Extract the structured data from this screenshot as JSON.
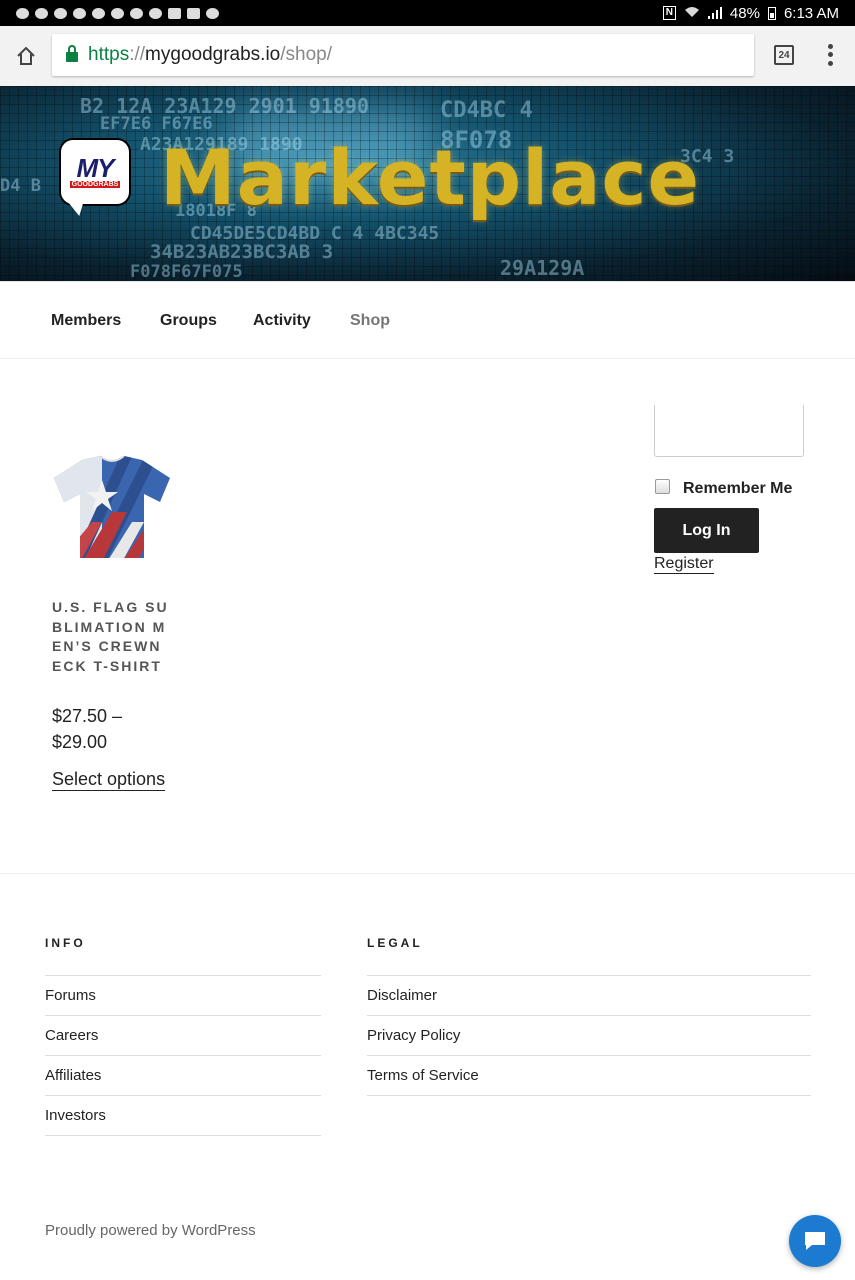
{
  "status_bar": {
    "battery": "48%",
    "time": "6:13 AM"
  },
  "browser": {
    "url_scheme": "https",
    "url_sep": "://",
    "url_host": "mygoodgrabs.io",
    "url_path": "/shop/",
    "tab_count": "24"
  },
  "header": {
    "logo_main": "MY",
    "logo_sub": "GOODGRABS",
    "title": "Marketplace"
  },
  "nav": {
    "items": [
      {
        "label": "Members"
      },
      {
        "label": "Groups"
      },
      {
        "label": "Activity"
      },
      {
        "label": "Shop",
        "current": true
      }
    ]
  },
  "product": {
    "title": "U.S. FLAG SUBLIMATION MEN’S CREWNECK T-SHIRT",
    "price_line1": "$27.50 –",
    "price_line2": "$29.00",
    "button": "Select options"
  },
  "login": {
    "remember_label": "Remember Me",
    "login_button": "Log In",
    "register_link": "Register"
  },
  "footer": {
    "info": {
      "heading": "INFO",
      "links": [
        "Forums",
        "Careers",
        "Affiliates",
        "Investors"
      ]
    },
    "legal": {
      "heading": "LEGAL",
      "links": [
        "Disclaimer",
        "Privacy Policy",
        "Terms of Service"
      ]
    },
    "powered": "Proudly powered by WordPress"
  },
  "colors": {
    "url_green": "#0b8043",
    "banner_gold": "#d6b325",
    "chat_blue": "#1c7ad0"
  }
}
